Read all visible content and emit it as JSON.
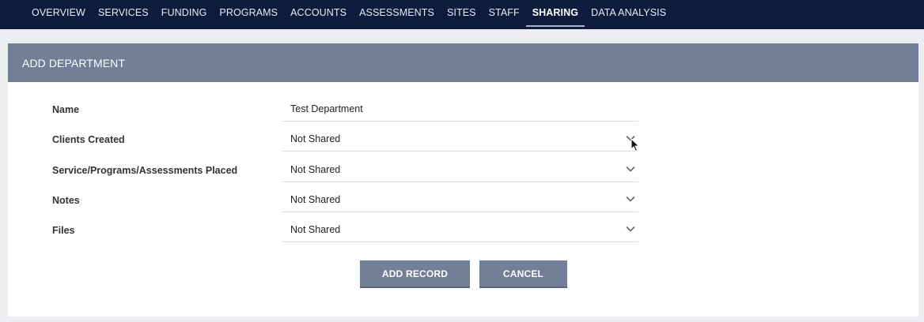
{
  "nav": {
    "items": [
      {
        "label": "OVERVIEW",
        "active": false
      },
      {
        "label": "SERVICES",
        "active": false
      },
      {
        "label": "FUNDING",
        "active": false
      },
      {
        "label": "PROGRAMS",
        "active": false
      },
      {
        "label": "ACCOUNTS",
        "active": false
      },
      {
        "label": "ASSESSMENTS",
        "active": false
      },
      {
        "label": "SITES",
        "active": false
      },
      {
        "label": "STAFF",
        "active": false
      },
      {
        "label": "SHARING",
        "active": true
      },
      {
        "label": "DATA ANALYSIS",
        "active": false
      }
    ]
  },
  "panel": {
    "title": "ADD DEPARTMENT"
  },
  "form": {
    "rows": [
      {
        "label": "Name",
        "value": "Test Department",
        "type": "text"
      },
      {
        "label": "Clients Created",
        "value": "Not Shared",
        "type": "select"
      },
      {
        "label": "Service/Programs/Assessments Placed",
        "value": "Not Shared",
        "type": "select"
      },
      {
        "label": "Notes",
        "value": "Not Shared",
        "type": "select"
      },
      {
        "label": "Files",
        "value": "Not Shared",
        "type": "select"
      }
    ]
  },
  "buttons": {
    "add_label": "ADD RECORD",
    "cancel_label": "CANCEL"
  },
  "colors": {
    "nav_bg": "#0d1b3d",
    "header_bg": "#717f97",
    "button_bg": "#717f97"
  },
  "icons": {
    "select_chevron": "chevron-down-icon",
    "pointer": "mouse-cursor-icon"
  }
}
